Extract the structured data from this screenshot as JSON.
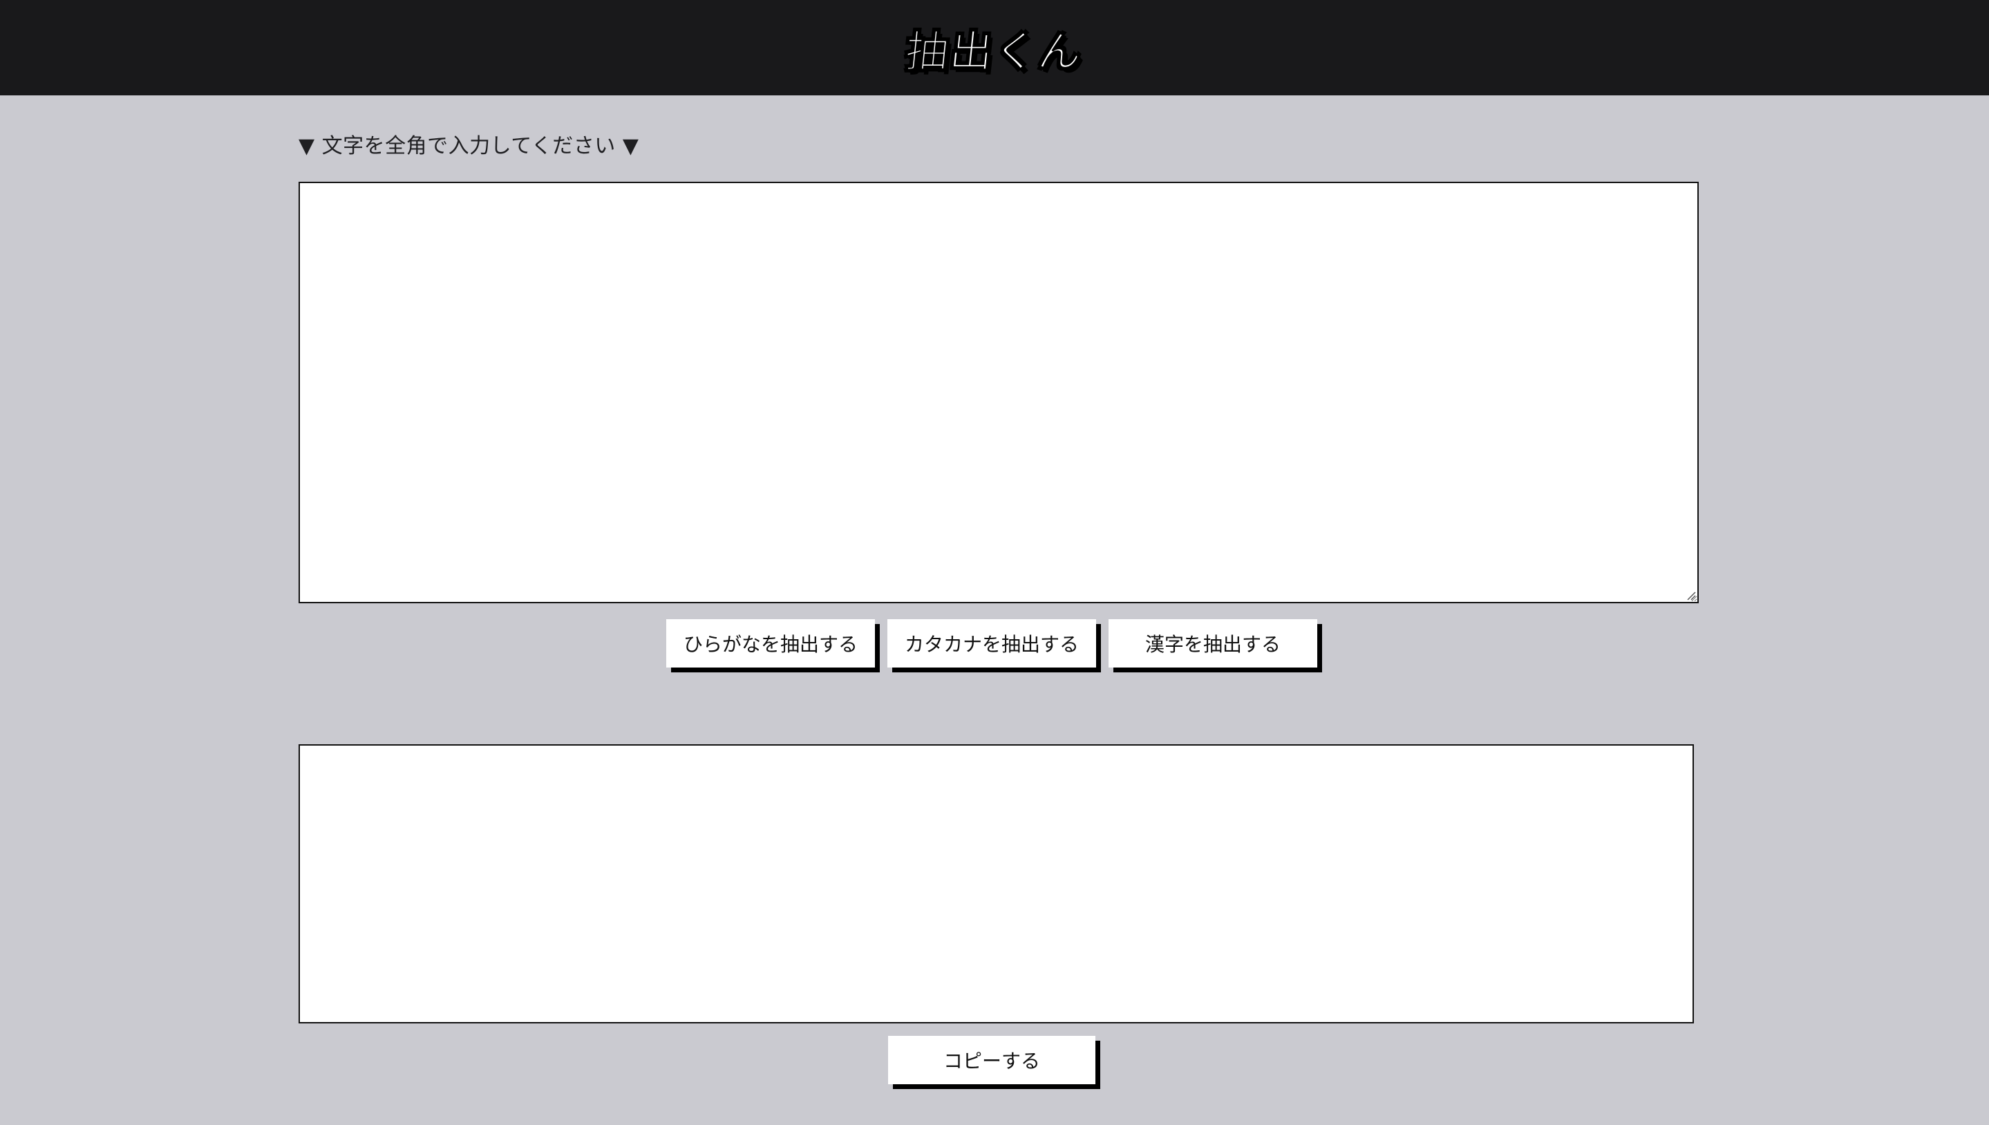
{
  "header": {
    "logo_text": "抽出くん"
  },
  "main": {
    "prompt_text": "▼ 文字を全角で入力してください ▼",
    "input_value": "",
    "buttons": [
      {
        "label": "ひらがなを抽出する"
      },
      {
        "label": "カタカナを抽出する"
      },
      {
        "label": "漢字を抽出する"
      }
    ],
    "output_value": "",
    "copy_label": "コピーする"
  },
  "colors": {
    "page_background": "#cacad0",
    "header_background": "#19191b",
    "button_background": "#ffffff",
    "button_shadow": "#000000"
  }
}
